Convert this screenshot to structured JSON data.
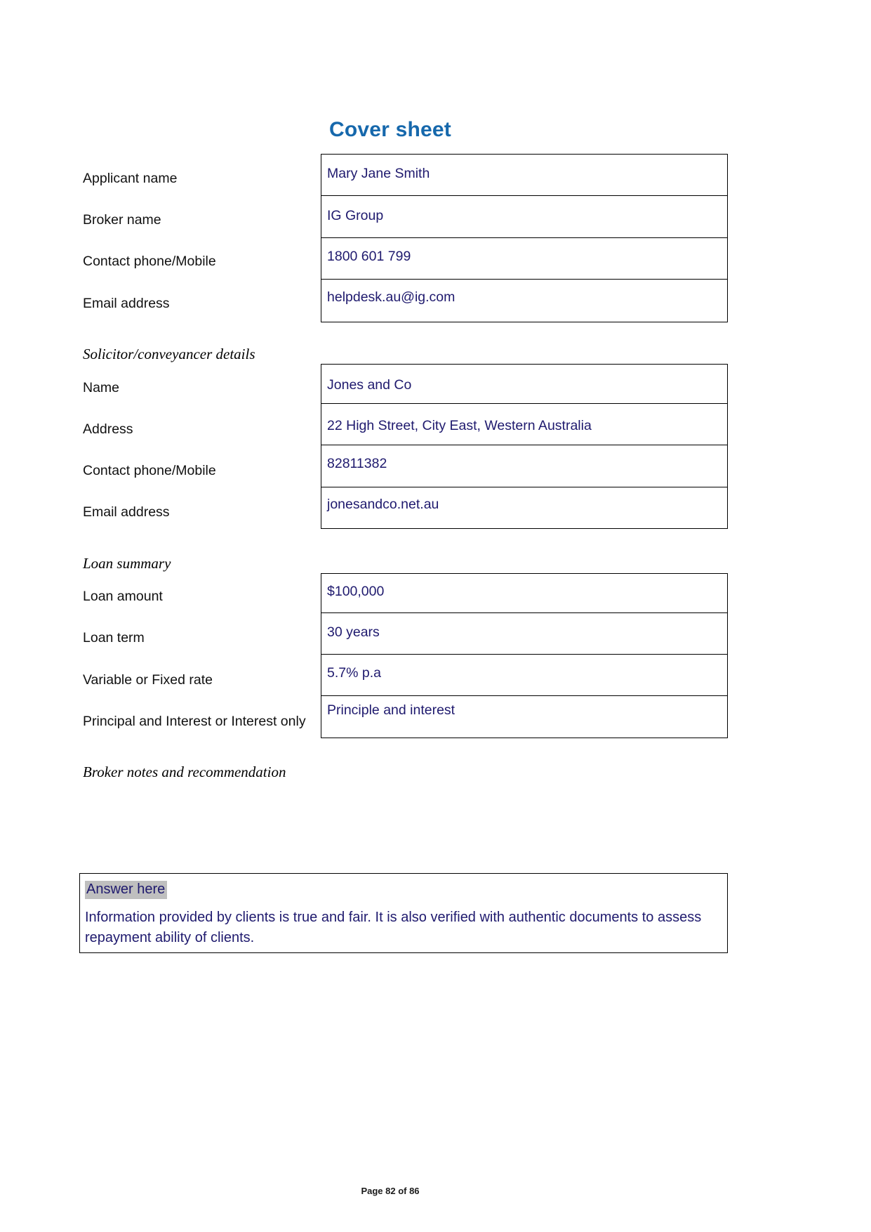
{
  "document": {
    "title": "Cover sheet",
    "title_color": "#1668ac",
    "value_text_color": "#1f1a6e",
    "highlight_color": "#bfbfbf",
    "footer": "Page 82 of 86"
  },
  "sections": [
    {
      "heading": "",
      "rows": [
        {
          "label": "Applicant name",
          "value": "Mary Jane Smith"
        },
        {
          "label": "Broker name",
          "value": "IG Group"
        },
        {
          "label": "Contact phone/Mobile",
          "value": "1800 601 799"
        },
        {
          "label": "Email address",
          "value": "helpdesk.au@ig.com"
        }
      ]
    },
    {
      "heading": "Solicitor/conveyancer details",
      "rows": [
        {
          "label": "Name",
          "value": "Jones and Co"
        },
        {
          "label": "Address",
          "value": "22 High Street, City East, Western Australia"
        },
        {
          "label": "Contact phone/Mobile",
          "value": "82811382"
        },
        {
          "label": "Email address",
          "value": "jonesandco.net.au"
        }
      ]
    },
    {
      "heading": "Loan summary",
      "rows": [
        {
          "label": "Loan amount",
          "value": "$100,000"
        },
        {
          "label": "Loan term",
          "value": "30 years"
        },
        {
          "label": "Variable or Fixed rate",
          "value": "5.7% p.a"
        },
        {
          "label": "Principal and Interest or Interest only",
          "value": "Principle and interest"
        }
      ]
    }
  ],
  "broker_notes": {
    "heading": "Broker notes and recommendation",
    "answer_placeholder": "Answer here",
    "paragraph": "Information provided by clients is true and fair. It is also verified with authentic documents to assess repayment ability of clients."
  }
}
